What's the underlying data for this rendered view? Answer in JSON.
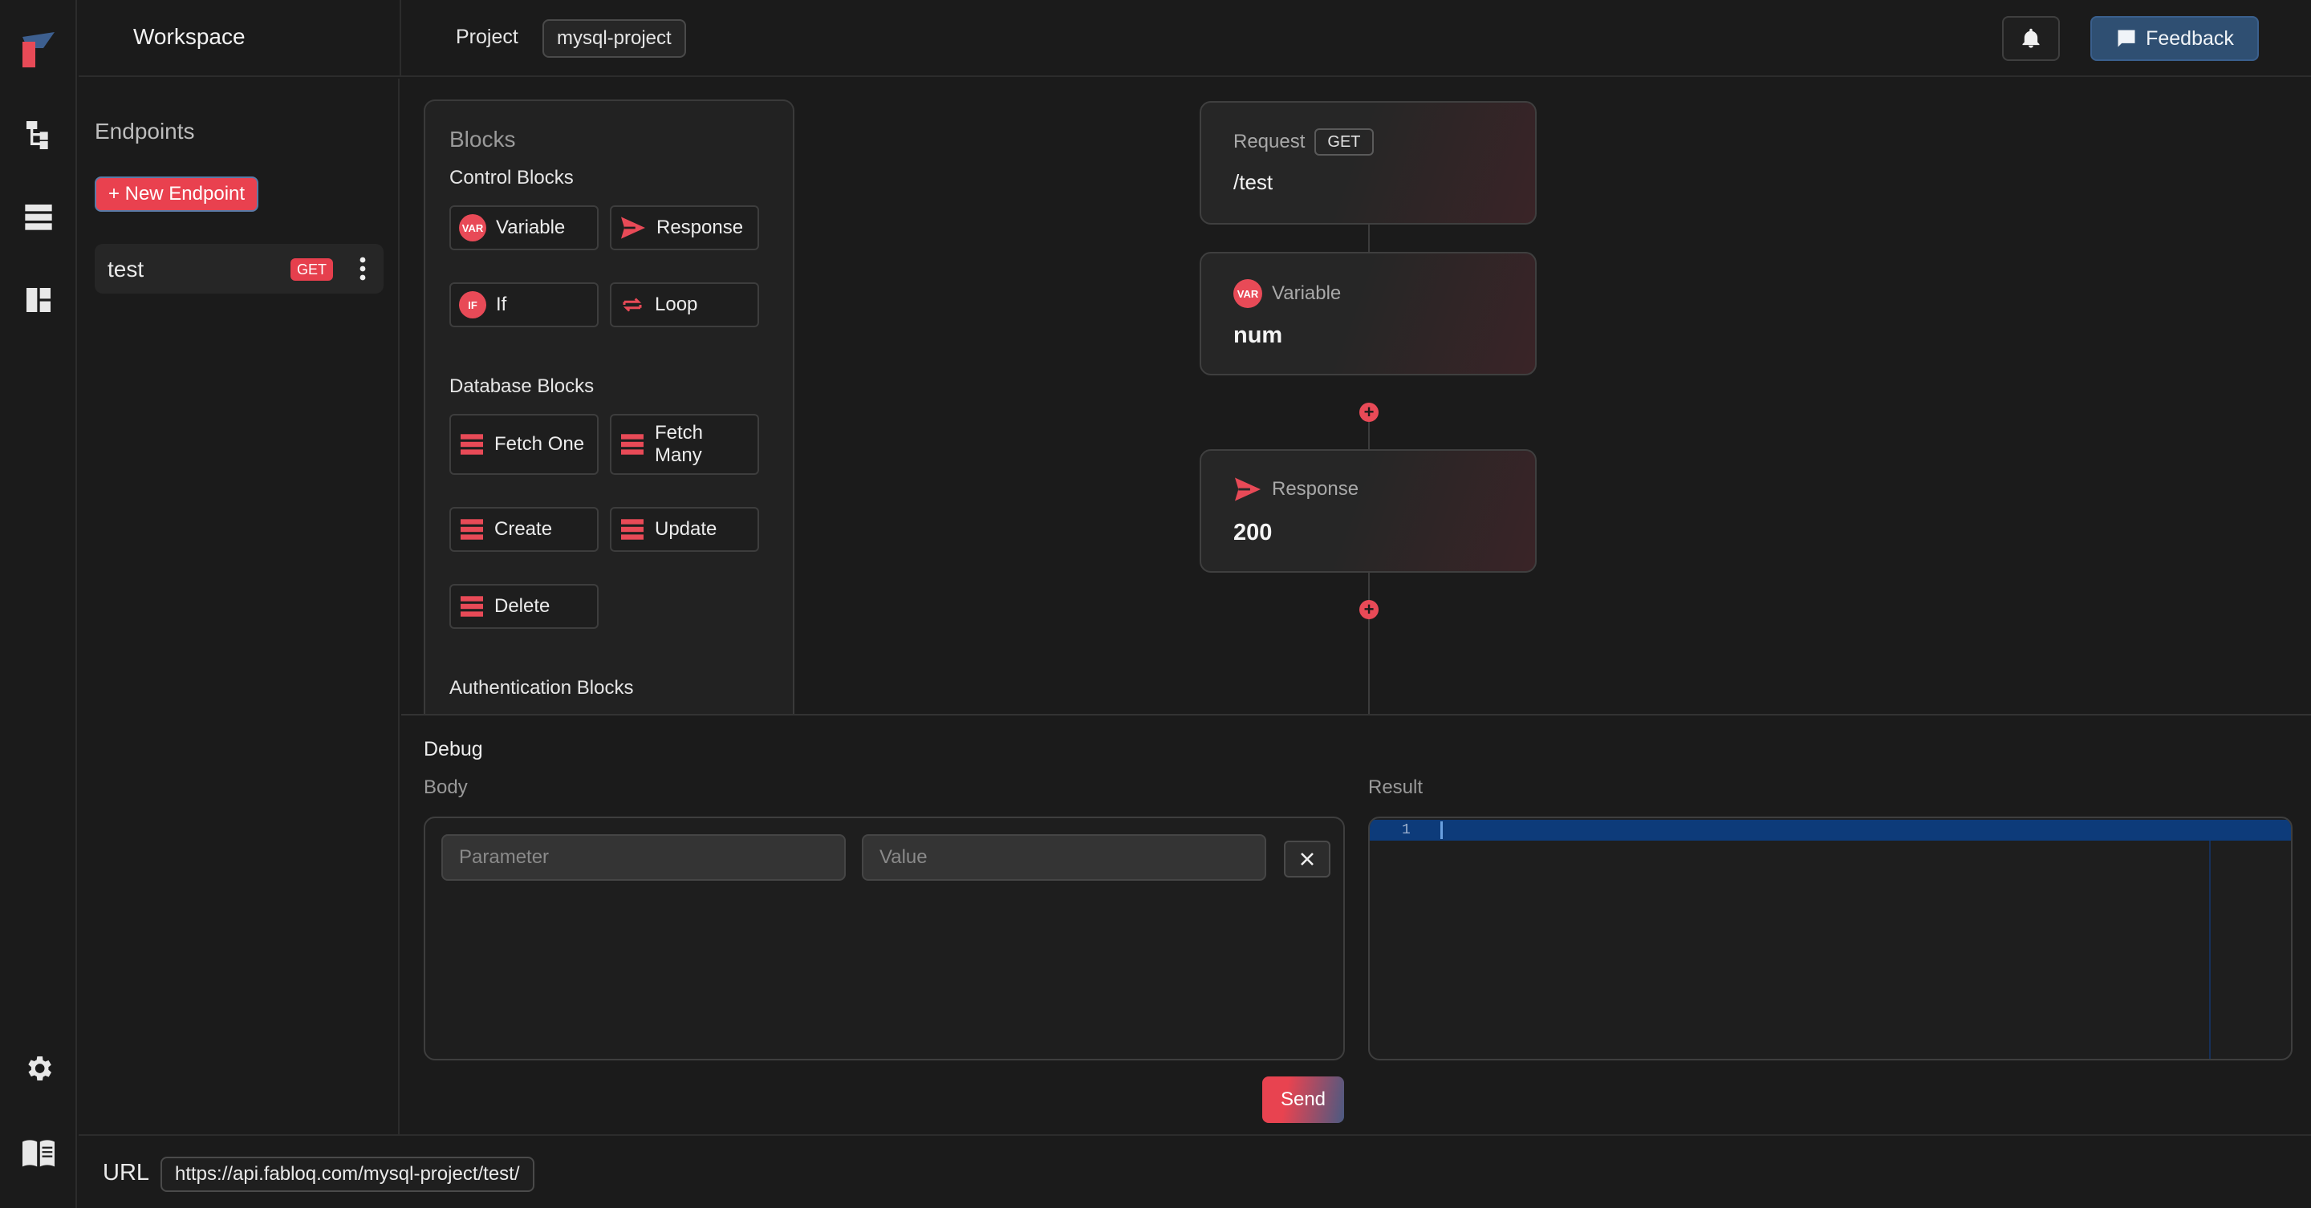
{
  "app": {
    "workspace_title": "Workspace"
  },
  "topbar": {
    "project_label": "Project",
    "project_name": "mysql-project",
    "feedback_label": "Feedback"
  },
  "sidebar": {
    "title": "Endpoints",
    "new_endpoint_label": "+ New Endpoint",
    "endpoints": [
      {
        "name": "test",
        "method": "GET"
      }
    ]
  },
  "blocks": {
    "title": "Blocks",
    "sections": {
      "control": {
        "title": "Control Blocks",
        "items": [
          "Variable",
          "Response",
          "If",
          "Loop"
        ]
      },
      "database": {
        "title": "Database Blocks",
        "items": [
          "Fetch One",
          "Fetch Many",
          "Create",
          "Update",
          "Delete"
        ]
      },
      "auth": {
        "title": "Authentication Blocks"
      }
    },
    "badges": {
      "var": "VAR",
      "if": "IF"
    }
  },
  "flow": {
    "request": {
      "label": "Request",
      "method": "GET",
      "path": "/test"
    },
    "variable": {
      "label": "Variable",
      "value": "num"
    },
    "response": {
      "label": "Response",
      "value": "200"
    },
    "plus": "+"
  },
  "debug": {
    "title": "Debug",
    "body_label": "Body",
    "result_label": "Result",
    "param_placeholder": "Parameter",
    "value_placeholder": "Value",
    "line_number": "1",
    "send_label": "Send"
  },
  "url": {
    "label": "URL",
    "value": "https://api.fabloq.com/mysql-project/test/"
  },
  "colors": {
    "accent": "#e84a57",
    "feedback": "#2f4f72",
    "background": "#1b1b1b"
  }
}
